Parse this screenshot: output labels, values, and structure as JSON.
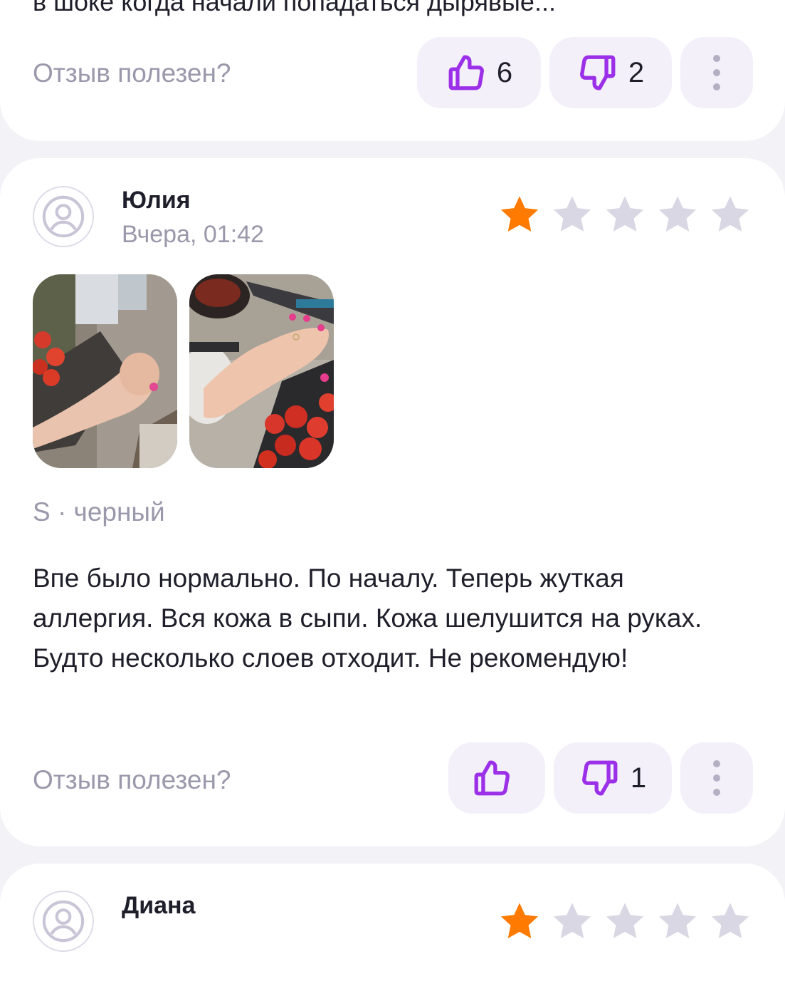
{
  "previous_review": {
    "cut_text": "в шоке когда начали попадаться дырявые...",
    "helpful_label": "Отзыв полезен?",
    "likes": "6",
    "dislikes": "2"
  },
  "review": {
    "author": "Юлия",
    "date": "Вчера, 01:42",
    "rating": 1,
    "rating_max": 5,
    "variant": "S · черный",
    "text": "Впе было нормально. По началу. Теперь жуткая аллергия. Вся кожа в сыпи. Кожа шелушится на руках. Будто несколько слоев отходит. Не рекомендую!",
    "helpful_label": "Отзыв полезен?",
    "likes": "",
    "dislikes": "1",
    "photos": [
      "photo-hand-tomatoes-1",
      "photo-hand-tomatoes-2"
    ]
  },
  "next_review": {
    "author": "Диана"
  },
  "colors": {
    "accent": "#9b30e8",
    "star_filled": "#ff7a00",
    "star_empty": "#d9d7e3",
    "muted_text": "#9a98ab",
    "button_bg": "#f3f0fa"
  },
  "icons": {
    "like": "thumbs-up-icon",
    "dislike": "thumbs-down-icon",
    "more": "more-vertical-icon",
    "avatar": "user-icon",
    "star": "star-icon"
  }
}
